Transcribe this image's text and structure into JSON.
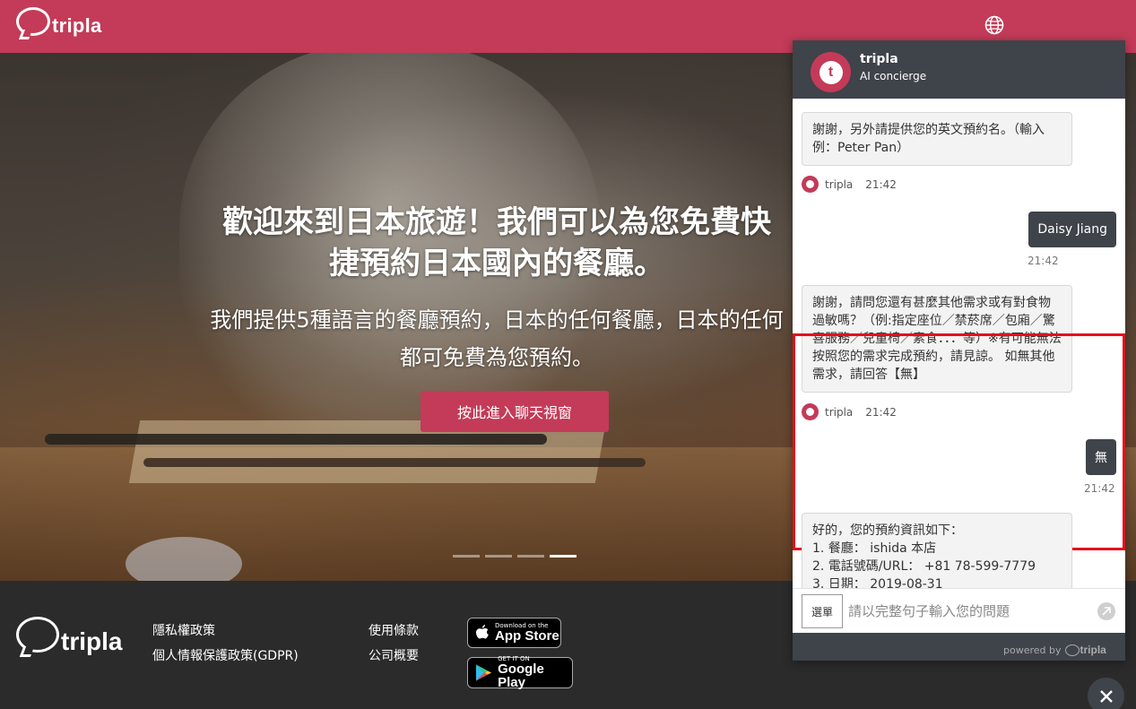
{
  "header": {
    "logo_text": "tripla",
    "globe_icon": "globe-icon"
  },
  "hero": {
    "title_line1": "歡迎來到日本旅遊！我們可以為您免費快",
    "title_line2": "捷預約日本國內的餐廳。",
    "sub_line1": "我們提供5種語言的餐廳預約，日本的任何餐廳，日本的任何",
    "sub_line2": "都可免費為您預約。",
    "cta_label": "按此進入聊天視窗",
    "slides": 4,
    "active_slide": 4
  },
  "footer": {
    "logo_text": "tripla",
    "links": [
      "隱私權政策",
      "個人情報保護政策(GDPR)",
      "使用條款",
      "公司概要"
    ],
    "app_store": {
      "small": "Download on the",
      "big": "App Store"
    },
    "google_play": {
      "small": "GET IT ON",
      "big": "Google Play"
    }
  },
  "chat": {
    "name": "tripla",
    "role": "AI concierge",
    "messages": [
      {
        "from": "bot",
        "text": "謝謝，另外請提供您的英文預約名。（輸入例：Peter Pan）",
        "sender": "tripla",
        "time": "21:42"
      },
      {
        "from": "user",
        "text": "Daisy Jiang",
        "time": "21:42"
      },
      {
        "from": "bot",
        "text": "謝謝，請問您還有甚麼其他需求或有對食物過敏嗎？（例:指定座位／禁菸席／包廂／驚喜服務／兒童椅／素食．．．等）※有可能無法按照您的需求完成預約，請見諒。 如無其他需求，請回答【無】",
        "sender": "tripla",
        "time": "21:42"
      },
      {
        "from": "user",
        "text": "無",
        "time": "21:42"
      },
      {
        "from": "bot",
        "lines": [
          "好的，您的預約資訊如下：",
          "1. 餐廳： ishida 本店",
          "2. 電話號碼/URL： +81 78-599-7779",
          "3. 日期： 2019-08-31"
        ]
      }
    ],
    "menu_label": "選單",
    "input_placeholder": "請以完整句子輸入您的問題",
    "powered_by": "powered by",
    "powered_brand": "tripla"
  },
  "colors": {
    "brand": "#c33b58",
    "chat_dark": "#3f434a",
    "highlight": "#e3101c"
  }
}
